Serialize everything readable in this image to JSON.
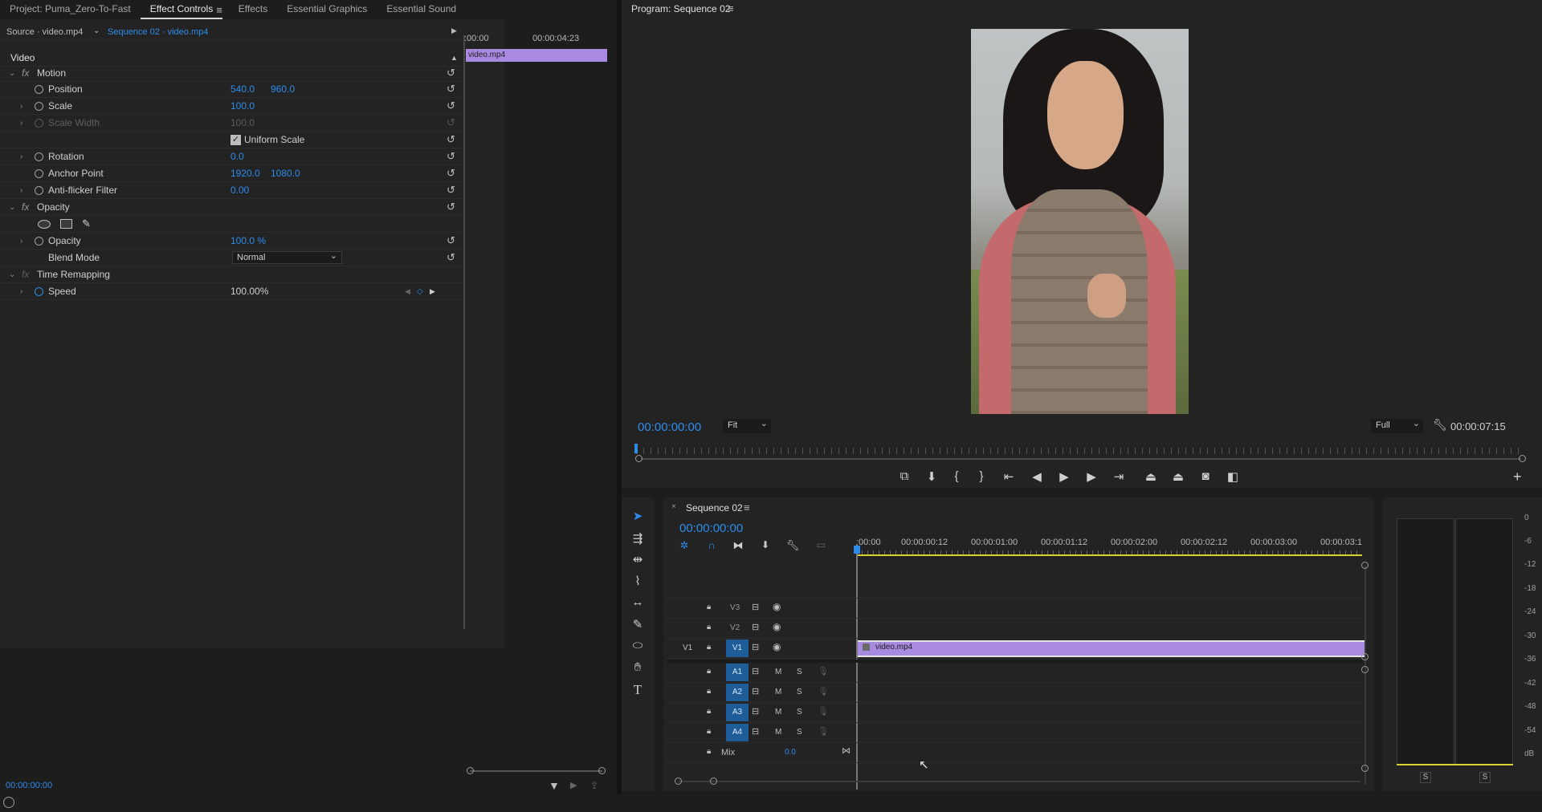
{
  "left_panel": {
    "tabs": [
      {
        "label": "Project: Puma_Zero-To-Fast"
      },
      {
        "label": "Effect Controls"
      },
      {
        "label": "Effects"
      },
      {
        "label": "Essential Graphics"
      },
      {
        "label": "Essential Sound"
      }
    ],
    "source_label": "Source · video.mp4",
    "sequence_clip": "Sequence 02 · video.mp4",
    "section_video": "Video",
    "motion": {
      "label": "Motion",
      "position": {
        "label": "Position",
        "x": "540.0",
        "y": "960.0"
      },
      "scale": {
        "label": "Scale",
        "value": "100.0"
      },
      "scale_width": {
        "label": "Scale Width",
        "value": "100.0"
      },
      "uniform_scale": {
        "label": "Uniform Scale",
        "checked": true
      },
      "rotation": {
        "label": "Rotation",
        "value": "0.0"
      },
      "anchor_point": {
        "label": "Anchor Point",
        "x": "1920.0",
        "y": "1080.0"
      },
      "anti_flicker": {
        "label": "Anti-flicker Filter",
        "value": "0.00"
      }
    },
    "opacity": {
      "label": "Opacity",
      "opacity": {
        "label": "Opacity",
        "value": "100.0 %"
      },
      "blend_mode": {
        "label": "Blend Mode",
        "value": "Normal"
      }
    },
    "time_remapping": {
      "label": "Time Remapping",
      "speed": {
        "label": "Speed",
        "value": "100.00%"
      }
    },
    "mini_timeline": {
      "start": ":00:00",
      "end": "00:00:04:23",
      "clip": "video.mp4"
    },
    "footer_timecode": "00:00:00:00"
  },
  "program": {
    "title": "Program: Sequence 02",
    "timecode": "00:00:00:00",
    "fit": "Fit",
    "quality": "Full",
    "duration": "00:00:07:15"
  },
  "timeline": {
    "sequence_tab": "Sequence 02",
    "timecode": "00:00:00:00",
    "ruler": [
      ":00:00",
      "00:00:00:12",
      "00:00:01:00",
      "00:00:01:12",
      "00:00:02:00",
      "00:00:02:12",
      "00:00:03:00",
      "00:00:03:1"
    ],
    "video_tracks": [
      {
        "name": "V3"
      },
      {
        "name": "V2"
      },
      {
        "name": "V1",
        "source": "V1"
      }
    ],
    "audio_tracks": [
      {
        "name": "A1"
      },
      {
        "name": "A2"
      },
      {
        "name": "A3"
      },
      {
        "name": "A4"
      }
    ],
    "mute_label": "M",
    "solo_label": "S",
    "mix": {
      "label": "Mix",
      "value": "0.0"
    },
    "clip": {
      "name": "video.mp4",
      "color": "#a88be0"
    }
  },
  "audio_meter": {
    "scale": [
      "0",
      "-6",
      "-12",
      "-18",
      "-24",
      "-30",
      "-36",
      "-42",
      "-48",
      "-54",
      "dB"
    ],
    "solo_buttons": [
      "S",
      "S"
    ]
  },
  "colors": {
    "accent": "#2d8ceb",
    "clip": "#a88be0",
    "track_target": "#1f5d99"
  }
}
